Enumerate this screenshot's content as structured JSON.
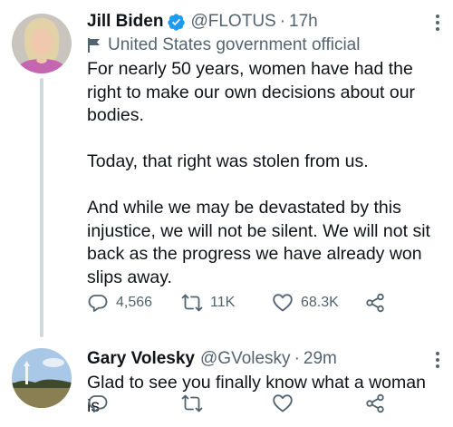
{
  "tweets": [
    {
      "name": "Jill Biden",
      "handle": "@FLOTUS",
      "separator": "·",
      "time": "17h",
      "label": "United States government official",
      "body": [
        "For nearly 50 years, women have had the right to make our own decisions about our bodies.",
        "Today, that right was stolen from us.",
        "And while we may be devastated by this injustice, we will not be silent. We will not sit back as the progress we have already won slips away."
      ],
      "replies": "4,566",
      "retweets": "11K",
      "likes": "68.3K",
      "verified": true,
      "icons": {
        "reply": "reply-icon",
        "retweet": "retweet-icon",
        "like": "heart-icon",
        "share": "share-icon",
        "label": "flag-icon",
        "more": "more-icon"
      }
    },
    {
      "name": "Gary Volesky",
      "handle": "@GVolesky",
      "separator": "·",
      "time": "29m",
      "body": [
        "Glad to see you finally know what a woman is"
      ],
      "replies": "",
      "retweets": "",
      "likes": ""
    }
  ],
  "colors": {
    "text": "#0f1419",
    "secondary": "#536471",
    "verified": "#1d9bf0",
    "thread_line": "#cfd9de"
  }
}
